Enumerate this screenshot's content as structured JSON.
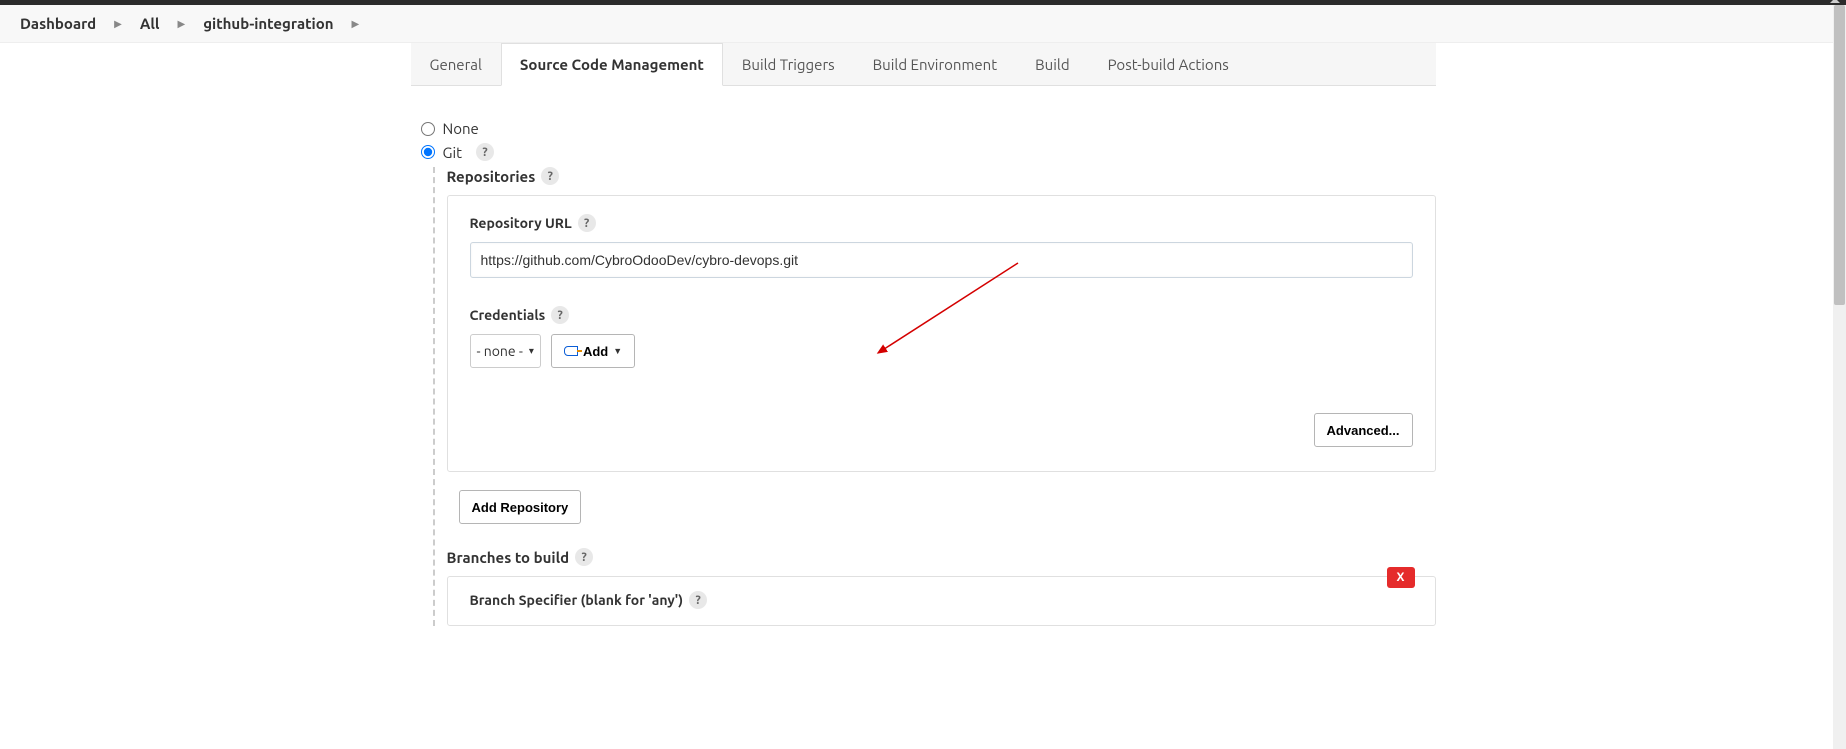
{
  "breadcrumb": [
    "Dashboard",
    "All",
    "github-integration"
  ],
  "tabs": [
    "General",
    "Source Code Management",
    "Build Triggers",
    "Build Environment",
    "Build",
    "Post-build Actions"
  ],
  "active_tab": 1,
  "scm": {
    "none_label": "None",
    "git_label": "Git",
    "repositories_label": "Repositories",
    "repo_url_label": "Repository URL",
    "repo_url_value": "https://github.com/CybroOdooDev/cybro-devops.git",
    "credentials_label": "Credentials",
    "credentials_value": "- none -",
    "add_btn": "Add",
    "advanced_btn": "Advanced...",
    "add_repo_btn": "Add Repository",
    "branches_label": "Branches to build",
    "branch_specifier_label": "Branch Specifier (blank for 'any')",
    "help": "?",
    "x": "X"
  }
}
